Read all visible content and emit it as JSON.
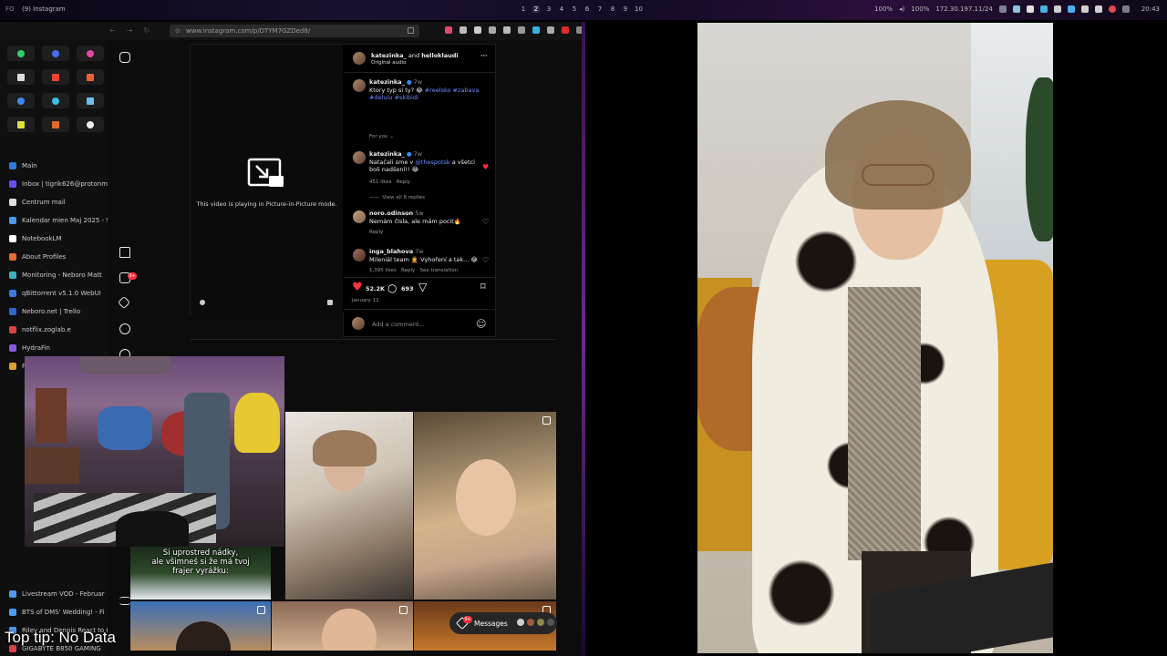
{
  "system_bar": {
    "window_title": "(9) Instagram",
    "workspaces": [
      "1",
      "2",
      "3",
      "4",
      "5",
      "6",
      "7",
      "8",
      "9",
      "10"
    ],
    "active_workspace": "2",
    "brightness": "100%",
    "volume": "100%",
    "ip": "172.30.197.11/24",
    "clock": "20:43"
  },
  "browser": {
    "url": "www.instagram.com/p/DTYM7GZDed8/",
    "tabs": [
      {
        "label": "Main",
        "color": "#2a7ee0"
      },
      {
        "label": "Inbox | tigrik626@protonm",
        "color": "#6d4aff"
      },
      {
        "label": "Centrum mail",
        "color": "#e0e0e0"
      },
      {
        "label": "Kalendar mien Maj 2025 - S",
        "color": "#4a9af0"
      },
      {
        "label": "NotebookLM",
        "color": "#ffffff"
      },
      {
        "label": "About Profiles",
        "color": "#f06a2a"
      },
      {
        "label": "Monitoring - Neboro Matt",
        "color": "#3ab0c0"
      },
      {
        "label": "qBittorrent v5.1.0 WebUI",
        "color": "#3a7ae0"
      },
      {
        "label": "Neboro.net | Trello",
        "color": "#2a6ad0"
      },
      {
        "label": "notflix.zoglab.e",
        "color": "#e04040"
      },
      {
        "label": "HydraFin",
        "color": "#8a5ae0"
      },
      {
        "label": "Photos - Immich",
        "color": "#e0a030"
      }
    ],
    "tabs_bottom": [
      {
        "label": "Livestream VOD - Februar",
        "color": "#4a9af0"
      },
      {
        "label": "BTS of DMS' Wedding! - Fi",
        "color": "#4a9af0"
      },
      {
        "label": "Riley and Dennis React to C",
        "color": "#4a9af0"
      },
      {
        "label": "GIGABYTE B850 GAMING",
        "color": "#e04040"
      }
    ]
  },
  "post": {
    "pip_text": "This video is playing in Picture-in-Picture mode.",
    "header_user": "katezinka_",
    "header_and": " and ",
    "header_collab": "helloklaudi",
    "header_audio": "Original audio",
    "caption_user": "katezinka_",
    "caption_time": "7w",
    "caption_text": "Ktory typ si ty? 😂 ",
    "caption_tags": "#reelsko #zabava #deluiu #skibidi",
    "for_you": "For you",
    "comments": [
      {
        "user": "katezinka_",
        "time": "7w",
        "pre": "Natačali sme v ",
        "mention": "@thespotsk",
        "post": " a všetci boli nadšení!! 😂",
        "likes": "451 likes",
        "reply": "Reply",
        "view_replies": "View all 8 replies"
      },
      {
        "user": "noro.odinson",
        "time": "5w",
        "text": "Nemám čísla, ale mám pocit🔥",
        "reply": "Reply"
      },
      {
        "user": "inga_blahova",
        "time": "7w",
        "text": "Mileniál team 🤦 Vyhoření a tak... 😂",
        "likes": "1,395 likes",
        "reply": "Reply",
        "translate": "See translation"
      }
    ],
    "like_count": "52.2K",
    "comment_count": "693",
    "date": "January 11",
    "add_comment_placeholder": "Add a comment..."
  },
  "grid": {
    "subtitle_line1": "Si uprostred nádky,",
    "subtitle_line2": "ale všimneš si že má tvoj",
    "subtitle_line3": "frajer vyrážku:"
  },
  "notifications_badge": "9+",
  "messages": {
    "label": "Messages",
    "badge": "9+"
  },
  "tip": "Top tip: No Data",
  "colors": {
    "like_red": "#ff3040",
    "link_blue": "#6f8cff",
    "ig_dark": "#000000"
  }
}
